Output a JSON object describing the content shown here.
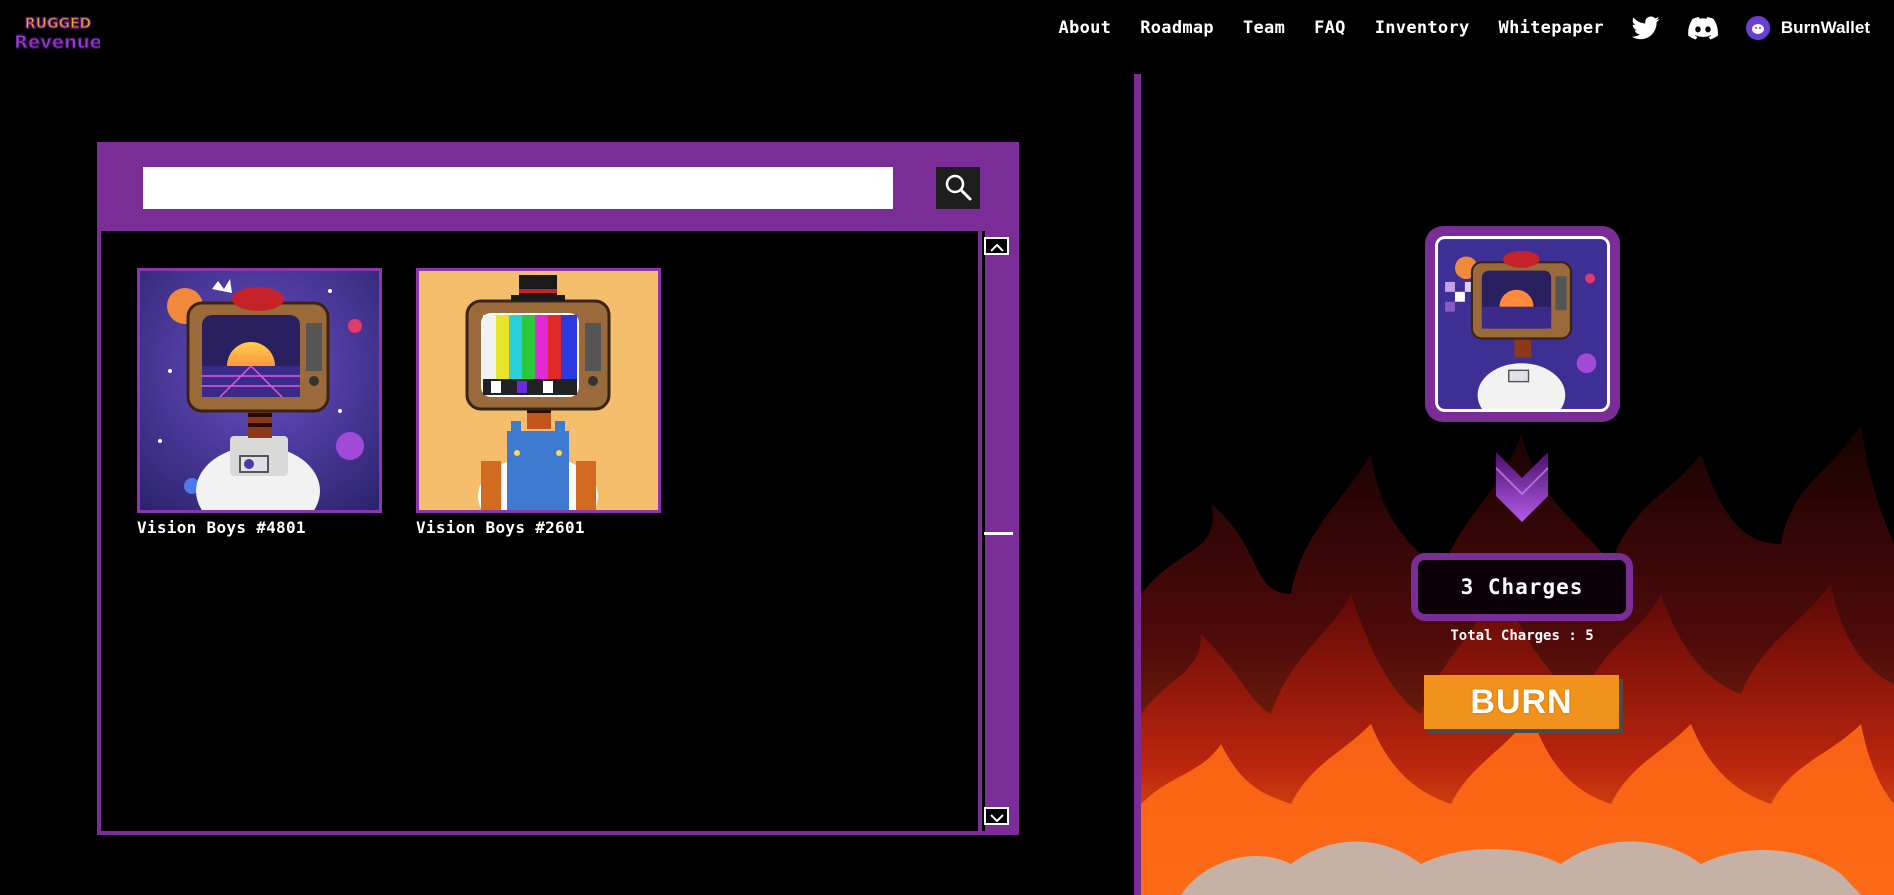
{
  "header": {
    "logo_alt": "Rugged Revenue",
    "nav": [
      "About",
      "Roadmap",
      "Team",
      "FAQ",
      "Inventory",
      "Whitepaper"
    ],
    "icons": [
      "twitter-icon",
      "discord-icon"
    ],
    "wallet_label": "BurnWallet"
  },
  "inventory": {
    "search": {
      "value": "",
      "placeholder": ""
    },
    "items": [
      {
        "label": "Vision Boys #4801",
        "theme": "space-astronaut",
        "bg_color": "#4b3aa6"
      },
      {
        "label": "Vision Boys #2601",
        "theme": "tv-overalls",
        "bg_color": "#f4be6c"
      }
    ]
  },
  "burn": {
    "charges_label": "3 Charges",
    "total_charges_label": "Total Charges : 5",
    "burn_button_label": "BURN"
  },
  "colors": {
    "accent": "#7a2d96",
    "burn_button": "#f0921c",
    "background": "#000000"
  }
}
